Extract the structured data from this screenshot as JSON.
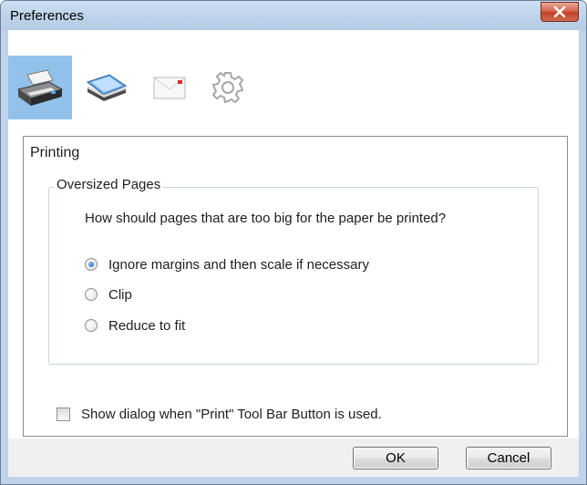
{
  "window": {
    "title": "Preferences",
    "close_icon": "close-x-icon"
  },
  "toolbar": {
    "items": [
      {
        "name": "printer",
        "icon": "printer-icon",
        "selected": true
      },
      {
        "name": "scanner",
        "icon": "scanner-icon",
        "selected": false
      },
      {
        "name": "email",
        "icon": "envelope-icon",
        "selected": false
      },
      {
        "name": "settings",
        "icon": "gear-icon",
        "selected": false
      }
    ],
    "selected_color": "#92c2ec"
  },
  "panel": {
    "title": "Printing",
    "group": {
      "legend": "Oversized Pages",
      "question": "How should pages that are too big for the paper be printed?",
      "options": [
        {
          "label": "Ignore margins and then scale if necessary",
          "checked": true
        },
        {
          "label": "Clip",
          "checked": false
        },
        {
          "label": "Reduce to fit",
          "checked": false
        }
      ]
    },
    "checkbox": {
      "label": "Show dialog when \"Print\" Tool Bar Button is used.",
      "checked": false
    }
  },
  "buttons": {
    "ok": "OK",
    "cancel": "Cancel"
  },
  "colors": {
    "frame": "#bfd3ea",
    "close_button": "#c2402a",
    "radio_selected": "#1b5fb3"
  }
}
